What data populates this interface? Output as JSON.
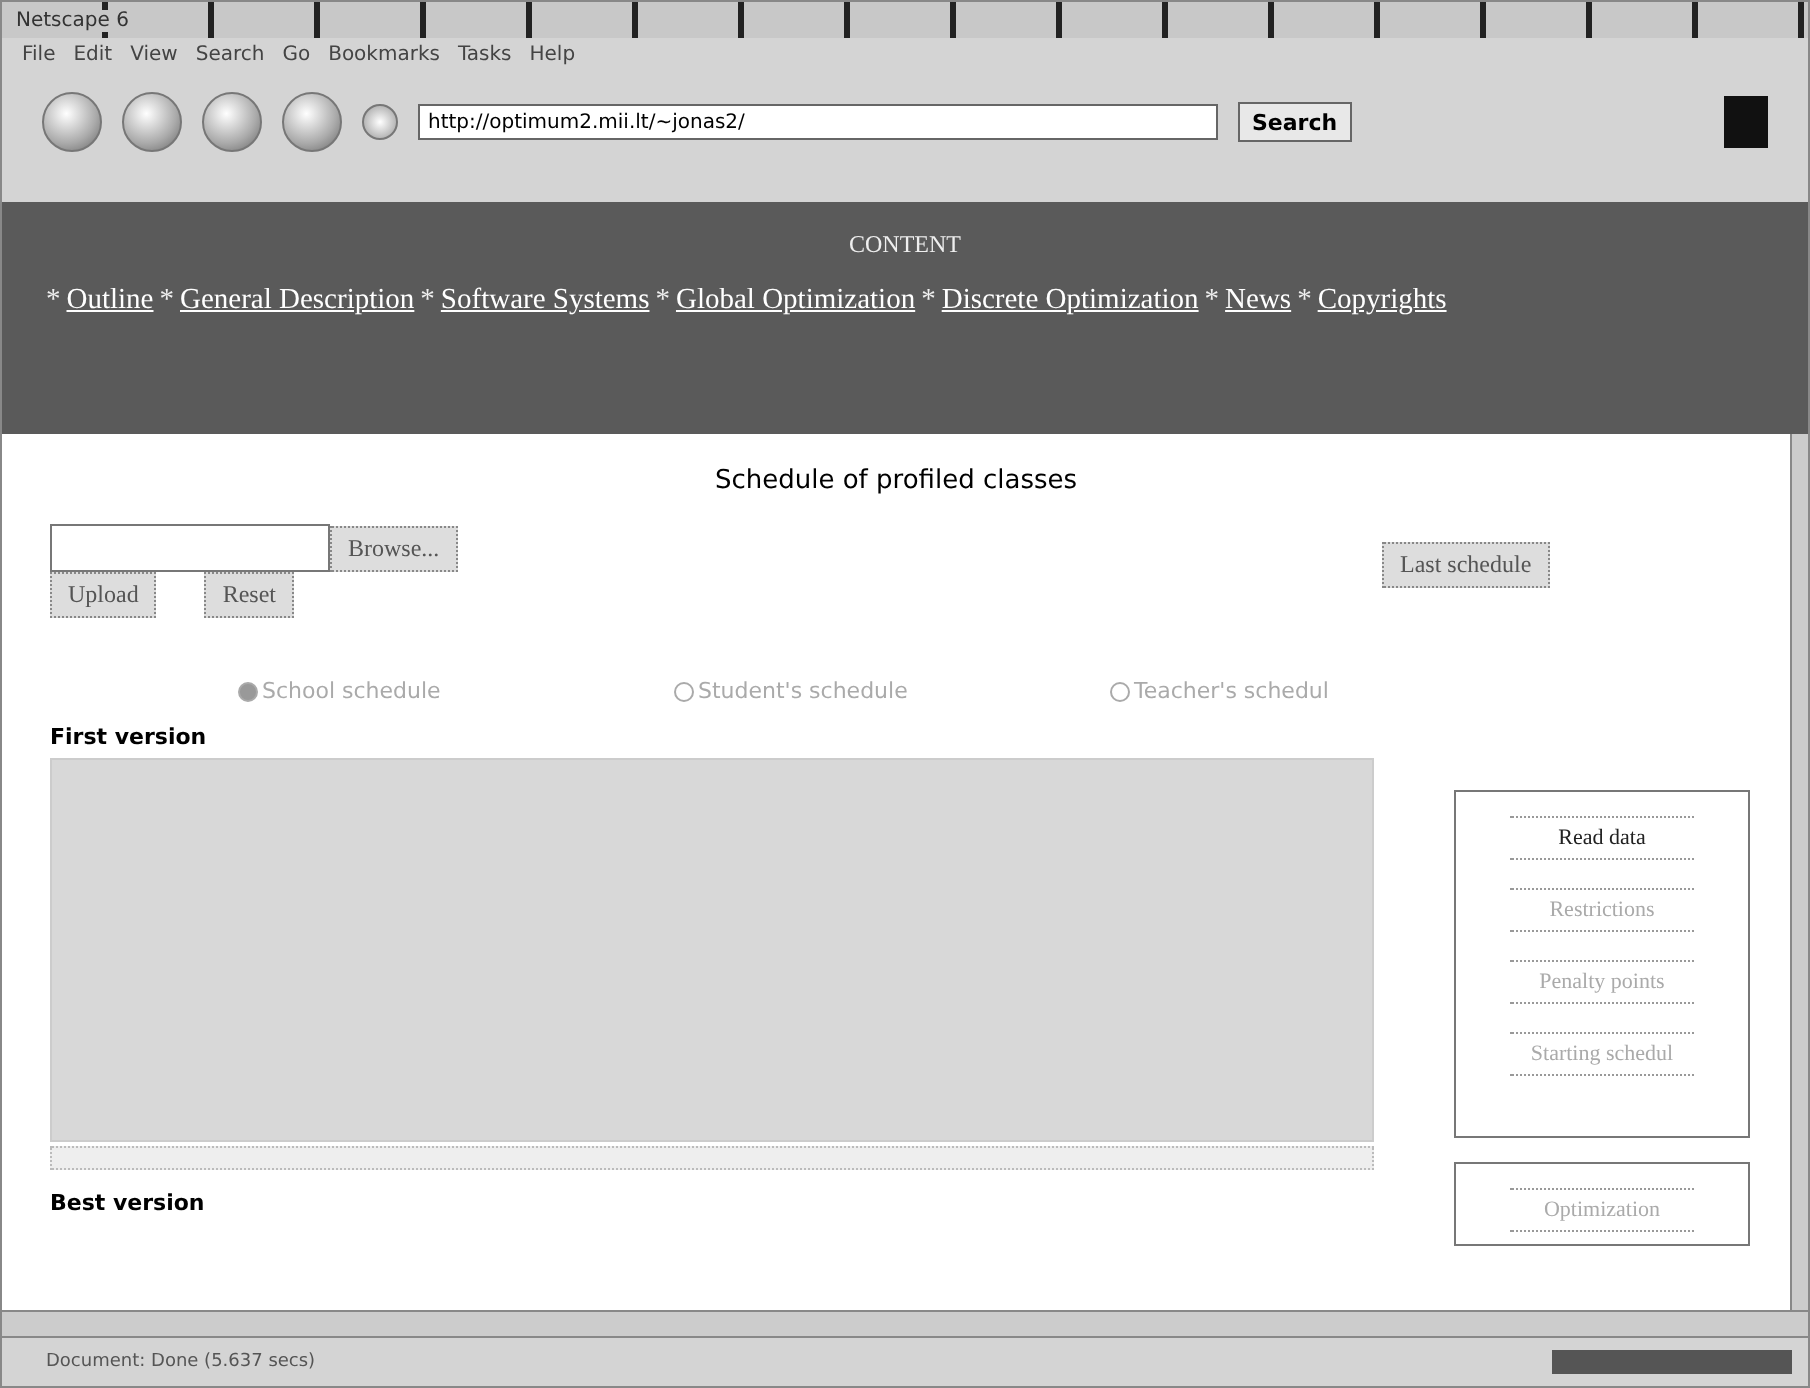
{
  "window": {
    "title": "Netscape 6"
  },
  "menu": [
    "File",
    "Edit",
    "View",
    "Search",
    "Go",
    "Bookmarks",
    "Tasks",
    "Help"
  ],
  "address": {
    "value": "http://optimum2.mii.lt/~jonas2/"
  },
  "search_button": "Search",
  "banner": {
    "heading": "CONTENT",
    "links": [
      {
        "bullet": "*",
        "label": "Outline"
      },
      {
        "bullet": "*",
        "label": "General Description"
      },
      {
        "bullet": "*",
        "label": "Software Systems"
      },
      {
        "bullet": "*",
        "label": "Global Optimization"
      },
      {
        "bullet": "*",
        "label": "Discrete Optimization"
      },
      {
        "bullet": "*",
        "label": "News"
      },
      {
        "bullet": "*",
        "label": "Copyrights"
      }
    ]
  },
  "page": {
    "title": "Schedule of profiled classes",
    "browse_button": "Browse...",
    "upload_button": "Upload",
    "reset_button": "Reset",
    "last_schedule_button": "Last schedule",
    "radios": [
      {
        "label": "School schedule",
        "selected": true
      },
      {
        "label": "Student's schedule",
        "selected": false
      },
      {
        "label": "Teacher's schedul",
        "selected": false
      }
    ],
    "first_version": "First version",
    "best_version": "Best version",
    "steps": [
      {
        "label": "Read data",
        "disabled": false
      },
      {
        "label": "Restrictions",
        "disabled": true
      },
      {
        "label": "Penalty points",
        "disabled": true
      },
      {
        "label": "Starting schedul",
        "disabled": true
      }
    ],
    "steps2": [
      {
        "label": "Optimization",
        "disabled": true
      }
    ]
  },
  "status_bar": {
    "text": "Document: Done (5.637 secs)"
  }
}
